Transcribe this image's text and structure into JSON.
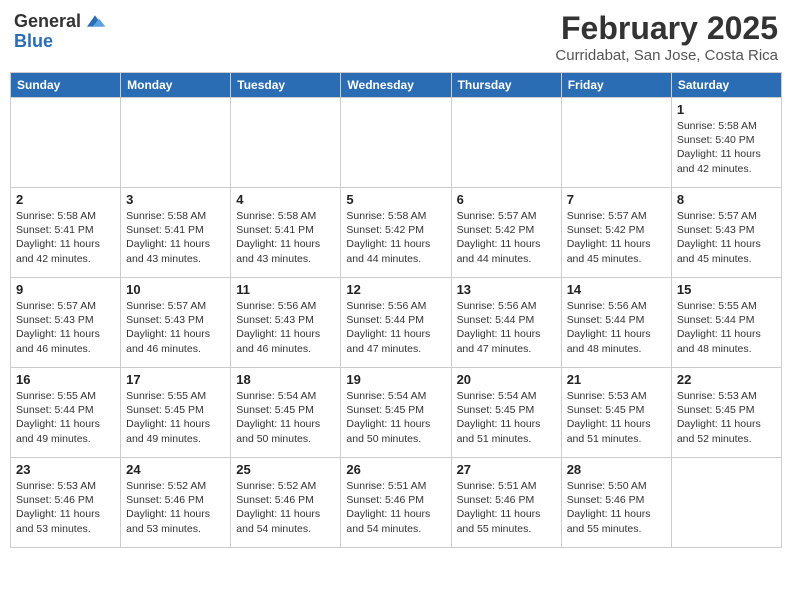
{
  "header": {
    "logo_general": "General",
    "logo_blue": "Blue",
    "month": "February 2025",
    "location": "Curridabat, San Jose, Costa Rica"
  },
  "days_of_week": [
    "Sunday",
    "Monday",
    "Tuesday",
    "Wednesday",
    "Thursday",
    "Friday",
    "Saturday"
  ],
  "weeks": [
    [
      {
        "day": "",
        "info": ""
      },
      {
        "day": "",
        "info": ""
      },
      {
        "day": "",
        "info": ""
      },
      {
        "day": "",
        "info": ""
      },
      {
        "day": "",
        "info": ""
      },
      {
        "day": "",
        "info": ""
      },
      {
        "day": "1",
        "info": "Sunrise: 5:58 AM\nSunset: 5:40 PM\nDaylight: 11 hours\nand 42 minutes."
      }
    ],
    [
      {
        "day": "2",
        "info": "Sunrise: 5:58 AM\nSunset: 5:41 PM\nDaylight: 11 hours\nand 42 minutes."
      },
      {
        "day": "3",
        "info": "Sunrise: 5:58 AM\nSunset: 5:41 PM\nDaylight: 11 hours\nand 43 minutes."
      },
      {
        "day": "4",
        "info": "Sunrise: 5:58 AM\nSunset: 5:41 PM\nDaylight: 11 hours\nand 43 minutes."
      },
      {
        "day": "5",
        "info": "Sunrise: 5:58 AM\nSunset: 5:42 PM\nDaylight: 11 hours\nand 44 minutes."
      },
      {
        "day": "6",
        "info": "Sunrise: 5:57 AM\nSunset: 5:42 PM\nDaylight: 11 hours\nand 44 minutes."
      },
      {
        "day": "7",
        "info": "Sunrise: 5:57 AM\nSunset: 5:42 PM\nDaylight: 11 hours\nand 45 minutes."
      },
      {
        "day": "8",
        "info": "Sunrise: 5:57 AM\nSunset: 5:43 PM\nDaylight: 11 hours\nand 45 minutes."
      }
    ],
    [
      {
        "day": "9",
        "info": "Sunrise: 5:57 AM\nSunset: 5:43 PM\nDaylight: 11 hours\nand 46 minutes."
      },
      {
        "day": "10",
        "info": "Sunrise: 5:57 AM\nSunset: 5:43 PM\nDaylight: 11 hours\nand 46 minutes."
      },
      {
        "day": "11",
        "info": "Sunrise: 5:56 AM\nSunset: 5:43 PM\nDaylight: 11 hours\nand 46 minutes."
      },
      {
        "day": "12",
        "info": "Sunrise: 5:56 AM\nSunset: 5:44 PM\nDaylight: 11 hours\nand 47 minutes."
      },
      {
        "day": "13",
        "info": "Sunrise: 5:56 AM\nSunset: 5:44 PM\nDaylight: 11 hours\nand 47 minutes."
      },
      {
        "day": "14",
        "info": "Sunrise: 5:56 AM\nSunset: 5:44 PM\nDaylight: 11 hours\nand 48 minutes."
      },
      {
        "day": "15",
        "info": "Sunrise: 5:55 AM\nSunset: 5:44 PM\nDaylight: 11 hours\nand 48 minutes."
      }
    ],
    [
      {
        "day": "16",
        "info": "Sunrise: 5:55 AM\nSunset: 5:44 PM\nDaylight: 11 hours\nand 49 minutes."
      },
      {
        "day": "17",
        "info": "Sunrise: 5:55 AM\nSunset: 5:45 PM\nDaylight: 11 hours\nand 49 minutes."
      },
      {
        "day": "18",
        "info": "Sunrise: 5:54 AM\nSunset: 5:45 PM\nDaylight: 11 hours\nand 50 minutes."
      },
      {
        "day": "19",
        "info": "Sunrise: 5:54 AM\nSunset: 5:45 PM\nDaylight: 11 hours\nand 50 minutes."
      },
      {
        "day": "20",
        "info": "Sunrise: 5:54 AM\nSunset: 5:45 PM\nDaylight: 11 hours\nand 51 minutes."
      },
      {
        "day": "21",
        "info": "Sunrise: 5:53 AM\nSunset: 5:45 PM\nDaylight: 11 hours\nand 51 minutes."
      },
      {
        "day": "22",
        "info": "Sunrise: 5:53 AM\nSunset: 5:45 PM\nDaylight: 11 hours\nand 52 minutes."
      }
    ],
    [
      {
        "day": "23",
        "info": "Sunrise: 5:53 AM\nSunset: 5:46 PM\nDaylight: 11 hours\nand 53 minutes."
      },
      {
        "day": "24",
        "info": "Sunrise: 5:52 AM\nSunset: 5:46 PM\nDaylight: 11 hours\nand 53 minutes."
      },
      {
        "day": "25",
        "info": "Sunrise: 5:52 AM\nSunset: 5:46 PM\nDaylight: 11 hours\nand 54 minutes."
      },
      {
        "day": "26",
        "info": "Sunrise: 5:51 AM\nSunset: 5:46 PM\nDaylight: 11 hours\nand 54 minutes."
      },
      {
        "day": "27",
        "info": "Sunrise: 5:51 AM\nSunset: 5:46 PM\nDaylight: 11 hours\nand 55 minutes."
      },
      {
        "day": "28",
        "info": "Sunrise: 5:50 AM\nSunset: 5:46 PM\nDaylight: 11 hours\nand 55 minutes."
      },
      {
        "day": "",
        "info": ""
      }
    ]
  ]
}
